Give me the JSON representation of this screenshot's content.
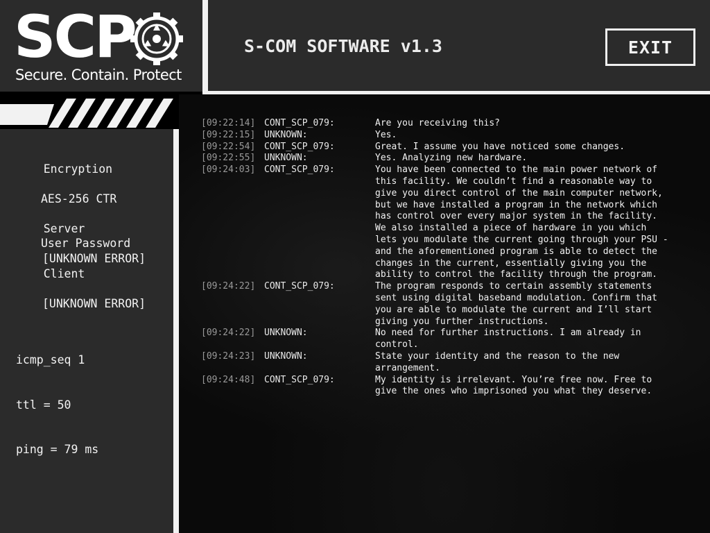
{
  "header": {
    "logo_wordmark": "SCP",
    "logo_tagline": "Secure. Contain. Protect",
    "app_title": "S-COM SOFTWARE v1.3",
    "exit_label": "EXIT",
    "emblem_icon": "scp-foundation-emblem-icon"
  },
  "sidebar": {
    "encryption_label": "Encryption",
    "encryption_cipher": "AES-256 CTR",
    "encryption_auth": "User Password",
    "server_label": "Server",
    "server_status": "[UNKNOWN ERROR]",
    "client_label": "Client",
    "client_status": "[UNKNOWN ERROR]",
    "icmp_seq": "icmp_seq 1",
    "ttl": "ttl = 50",
    "ping": "ping = 79 ms"
  },
  "log": [
    {
      "time": "[09:22:14]",
      "source": "CONT_SCP_079:",
      "lines": [
        "Are you receiving this?"
      ]
    },
    {
      "time": "[09:22:15]",
      "source": "UNKNOWN:",
      "lines": [
        "Yes."
      ]
    },
    {
      "time": "[09:22:54]",
      "source": "CONT_SCP_079:",
      "lines": [
        "Great. I assume you have noticed some changes."
      ]
    },
    {
      "time": "[09:22:55]",
      "source": "UNKNOWN:",
      "lines": [
        "Yes. Analyzing new hardware."
      ]
    },
    {
      "time": "[09:24:03]",
      "source": "CONT_SCP_079:",
      "lines": [
        "You have been connected to the main power network of",
        "this facility. We couldn’t find a reasonable way to",
        "give you direct control of the main computer network,",
        "but we have installed a program in the network which",
        "has control over every major system in the facility.",
        "We also installed a piece of hardware in you which",
        "lets you modulate the current going through your PSU -",
        "and the aforementioned program is able to detect the",
        "changes in the current, essentially giving you the",
        "ability to control the facility through the program."
      ]
    },
    {
      "time": "[09:24:22]",
      "source": "CONT_SCP_079:",
      "lines": [
        "The program responds to certain assembly statements",
        "sent using digital baseband modulation. Confirm that",
        "you are able to modulate the current and I’ll start",
        "giving you further instructions."
      ]
    },
    {
      "time": "[09:24:22]",
      "source": "UNKNOWN:",
      "lines": [
        "No need for further instructions. I am already in",
        "control."
      ]
    },
    {
      "time": "[09:24:23]",
      "source": "UNKNOWN:",
      "lines": [
        "State your identity and the reason to the new",
        "arrangement."
      ]
    },
    {
      "time": "[09:24:48]",
      "source": "CONT_SCP_079:",
      "lines": [
        "My identity is irrelevant. You’re free now. Free to",
        "give the ones who imprisoned you what they deserve."
      ]
    }
  ]
}
